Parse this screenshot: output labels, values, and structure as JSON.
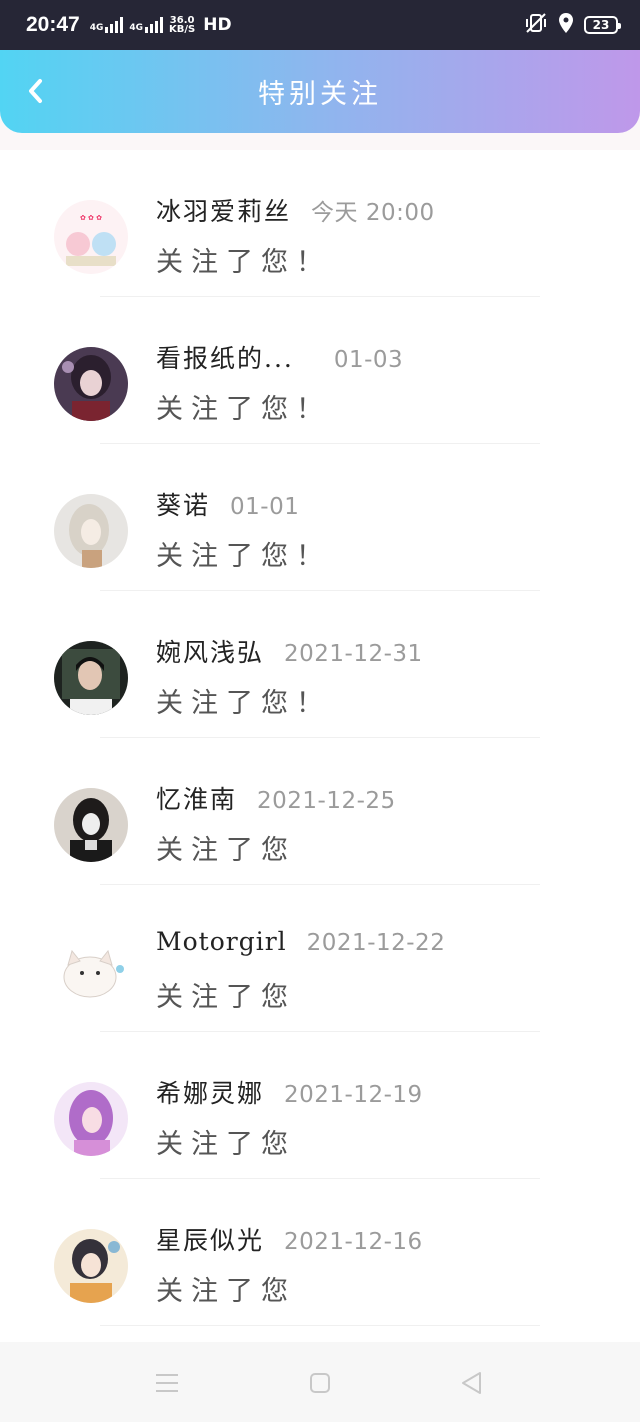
{
  "status_bar": {
    "time": "20:47",
    "net1": "4G",
    "net2": "4G",
    "speed_value": "36.0",
    "speed_unit": "KB/S",
    "hd": "HD",
    "battery": "23"
  },
  "header": {
    "title": "特别关注"
  },
  "items": [
    {
      "name": "冰羽爱莉丝",
      "date": "今天 20:00",
      "message": "关注了您！"
    },
    {
      "name": "看报纸的...",
      "date": "01-03",
      "message": "关注了您！"
    },
    {
      "name": "葵诺",
      "date": "01-01",
      "message": "关注了您！"
    },
    {
      "name": "婉风浅弘",
      "date": "2021-12-31",
      "message": "关注了您！"
    },
    {
      "name": "忆淮南",
      "date": "2021-12-25",
      "message": "关注了您"
    },
    {
      "name": "Motorgirl",
      "date": "2021-12-22",
      "message": "关注了您"
    },
    {
      "name": "希娜灵娜",
      "date": "2021-12-19",
      "message": "关注了您"
    },
    {
      "name": "星辰似光",
      "date": "2021-12-16",
      "message": "关注了您"
    }
  ],
  "colors": {
    "header_gradient_start": "#52d4f3",
    "header_gradient_end": "#bf98ea",
    "status_bar": "#262636"
  }
}
